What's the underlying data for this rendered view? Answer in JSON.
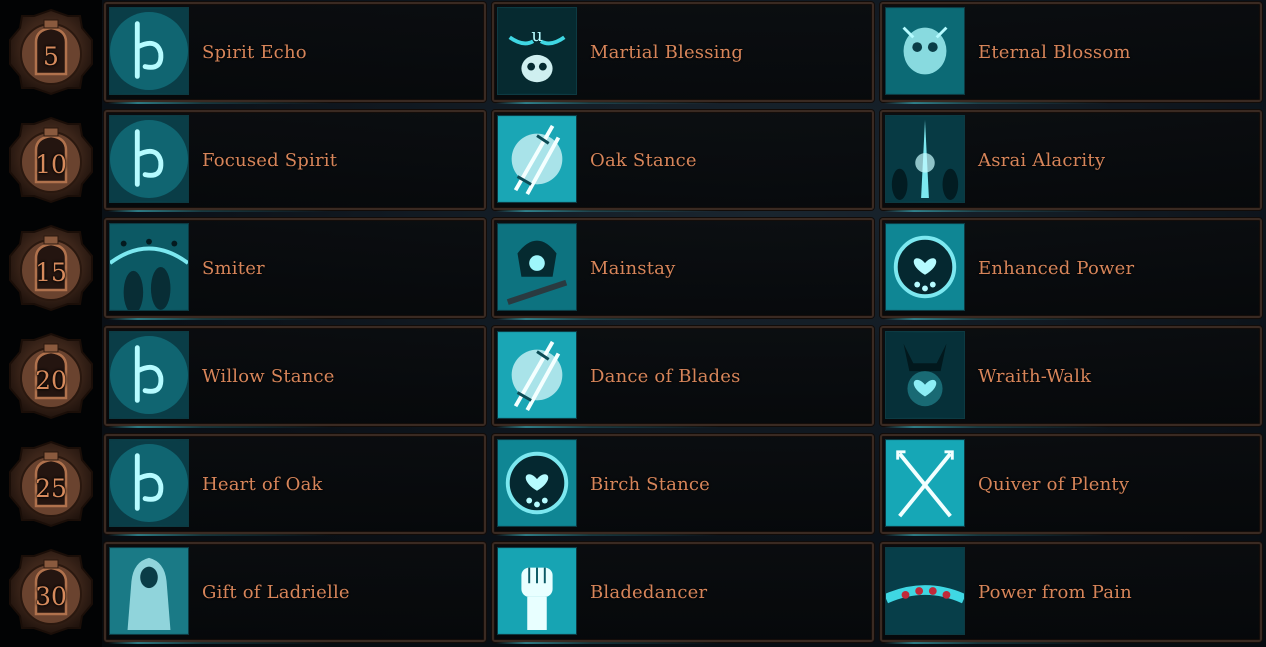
{
  "colors": {
    "label_text": "#d7855a",
    "badge_text": "#d68a5c",
    "icon_glow": "#3fd7e3",
    "cell_border": "#3a2a22"
  },
  "tiers": [
    {
      "level": "5",
      "talents": [
        {
          "name": "Spirit Echo",
          "icon": "rune-icon"
        },
        {
          "name": "Martial Blessing",
          "icon": "winged-skull-icon"
        },
        {
          "name": "Eternal Blossom",
          "icon": "glowing-skull-icon"
        }
      ]
    },
    {
      "level": "10",
      "talents": [
        {
          "name": "Focused Spirit",
          "icon": "rune-icon"
        },
        {
          "name": "Oak Stance",
          "icon": "crossed-blades-icon"
        },
        {
          "name": "Asrai Alacrity",
          "icon": "glowing-spear-icon"
        }
      ]
    },
    {
      "level": "15",
      "talents": [
        {
          "name": "Smiter",
          "icon": "warriors-silhouette-icon"
        },
        {
          "name": "Mainstay",
          "icon": "helmed-warrior-icon"
        },
        {
          "name": "Enhanced Power",
          "icon": "heart-drops-icon"
        }
      ]
    },
    {
      "level": "20",
      "talents": [
        {
          "name": "Willow Stance",
          "icon": "rune-icon"
        },
        {
          "name": "Dance of Blades",
          "icon": "crossed-blades-icon"
        },
        {
          "name": "Wraith-Walk",
          "icon": "horned-heart-icon"
        }
      ]
    },
    {
      "level": "25",
      "talents": [
        {
          "name": "Heart of Oak",
          "icon": "rune-icon"
        },
        {
          "name": "Birch Stance",
          "icon": "heart-drops-icon"
        },
        {
          "name": "Quiver of Plenty",
          "icon": "crossed-arrows-icon"
        }
      ]
    },
    {
      "level": "30",
      "talents": [
        {
          "name": "Gift of Ladrielle",
          "icon": "hooded-figure-icon"
        },
        {
          "name": "Bladedancer",
          "icon": "raised-fist-icon"
        },
        {
          "name": "Power from Pain",
          "icon": "gem-bracelet-icon"
        }
      ]
    }
  ]
}
